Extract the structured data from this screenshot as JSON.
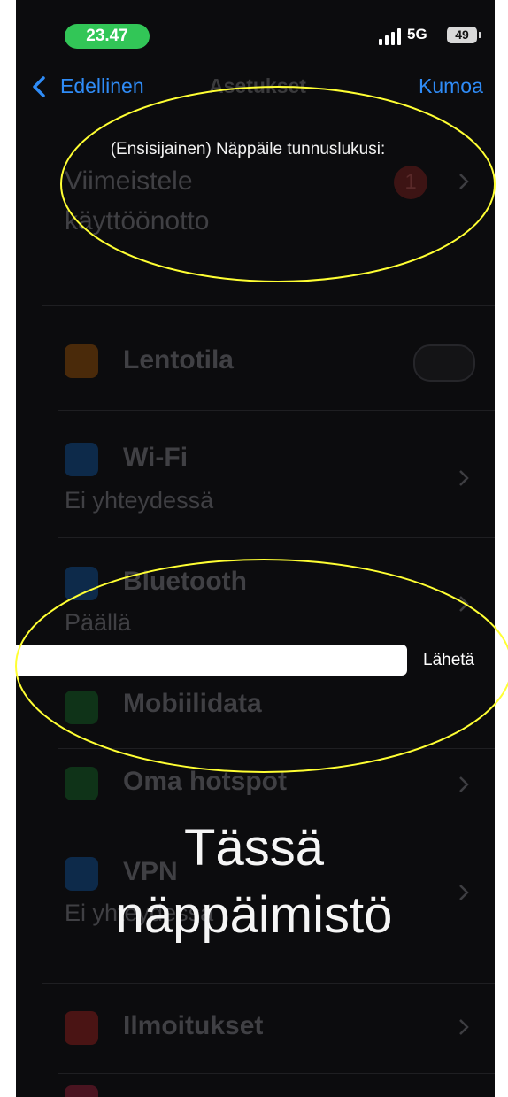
{
  "status_bar": {
    "time": "23.47",
    "network": "5G",
    "battery": "49"
  },
  "nav": {
    "back_label": "Edellinen",
    "title": "Asetukset",
    "cancel_label": "Kumoa"
  },
  "prompt": {
    "text": "(Ensisijainen) Näppäile tunnuslukusi:"
  },
  "input": {
    "value": "",
    "placeholder": "",
    "send_label": "Lähetä"
  },
  "settings": {
    "finish_setup": {
      "line1": "Viimeistele",
      "line2": "käyttöönotto",
      "badge": "1"
    },
    "rows": [
      {
        "title": "Lentotila",
        "subtitle": ""
      },
      {
        "title": "Wi-Fi",
        "subtitle": "Ei yhteydessä"
      },
      {
        "title": "Bluetooth",
        "subtitle": "Päällä"
      },
      {
        "title": "Mobiilidata",
        "subtitle": ""
      },
      {
        "title": "Oma hotspot",
        "subtitle": ""
      },
      {
        "title": "VPN",
        "subtitle": "Ei yhteydessä"
      },
      {
        "title": "Ilmoitukset",
        "subtitle": ""
      }
    ]
  },
  "overlay": {
    "line1": "Tässä",
    "line2": "näppäimistö"
  },
  "colors": {
    "accent": "#2f8cf7",
    "status_green": "#32c657",
    "annotation": "#ffff33"
  }
}
